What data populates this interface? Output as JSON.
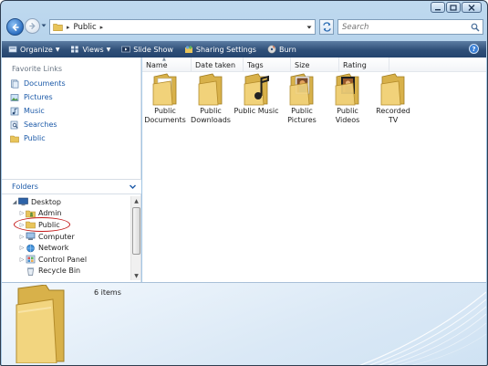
{
  "window": {
    "min_label": "",
    "max_label": "",
    "close_label": ""
  },
  "address": {
    "crumbs": [
      "Public"
    ],
    "separator": "▸"
  },
  "search": {
    "placeholder": "Search"
  },
  "toolbar": {
    "organize": "Organize",
    "views": "Views",
    "slideshow": "Slide Show",
    "sharing": "Sharing Settings",
    "burn": "Burn",
    "help": "?"
  },
  "nav": {
    "favorites_title": "Favorite Links",
    "favorites": [
      {
        "label": "Documents",
        "icon": "documents-icon"
      },
      {
        "label": "Pictures",
        "icon": "pictures-icon"
      },
      {
        "label": "Music",
        "icon": "music-icon"
      },
      {
        "label": "Searches",
        "icon": "searches-icon"
      },
      {
        "label": "Public",
        "icon": "folder-icon"
      }
    ],
    "folders_title": "Folders",
    "tree": [
      {
        "label": "Desktop",
        "icon": "desktop-icon",
        "expanded": true,
        "indent": 0
      },
      {
        "label": "Admin",
        "icon": "user-folder-icon",
        "expanded": false,
        "indent": 1
      },
      {
        "label": "Public",
        "icon": "folder-icon",
        "expanded": false,
        "indent": 1,
        "selected": true
      },
      {
        "label": "Computer",
        "icon": "computer-icon",
        "expanded": false,
        "indent": 1
      },
      {
        "label": "Network",
        "icon": "network-icon",
        "expanded": false,
        "indent": 1
      },
      {
        "label": "Control Panel",
        "icon": "control-panel-icon",
        "expanded": false,
        "indent": 1
      },
      {
        "label": "Recycle Bin",
        "icon": "recycle-bin-icon",
        "expanded": null,
        "indent": 1
      }
    ]
  },
  "columns": [
    "Name",
    "Date taken",
    "Tags",
    "Size",
    "Rating"
  ],
  "items": [
    {
      "label": "Public Documents",
      "overlay": "none"
    },
    {
      "label": "Public Downloads",
      "overlay": "none"
    },
    {
      "label": "Public Music",
      "overlay": "music"
    },
    {
      "label": "Public Pictures",
      "overlay": "pictures"
    },
    {
      "label": "Public Videos",
      "overlay": "videos"
    },
    {
      "label": "Recorded TV",
      "overlay": "none"
    }
  ],
  "details": {
    "count": "6 items"
  },
  "colors": {
    "link": "#1c5aa8",
    "toolbar": "#2f4f78",
    "highlight_ring": "#c41a1a",
    "folder": "#e8c45a"
  }
}
